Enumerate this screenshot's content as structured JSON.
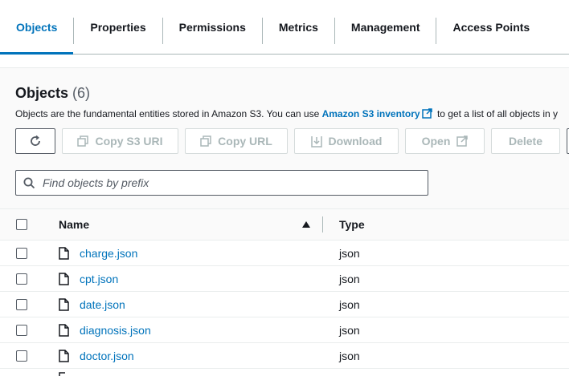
{
  "tabs": [
    {
      "label": "Objects",
      "active": true
    },
    {
      "label": "Properties",
      "active": false
    },
    {
      "label": "Permissions",
      "active": false
    },
    {
      "label": "Metrics",
      "active": false
    },
    {
      "label": "Management",
      "active": false
    },
    {
      "label": "Access Points",
      "active": false
    }
  ],
  "objects": {
    "title": "Objects",
    "count": "(6)",
    "description_before": "Objects are the fundamental entities stored in Amazon S3. You can use ",
    "description_link": "Amazon S3 inventory",
    "description_after": " to get a list of all objects in y"
  },
  "actions": {
    "copy_s3_uri": "Copy S3 URI",
    "copy_url": "Copy URL",
    "download": "Download",
    "open": "Open",
    "delete": "Delete"
  },
  "search": {
    "placeholder": "Find objects by prefix"
  },
  "table": {
    "columns": {
      "name": "Name",
      "type": "Type"
    },
    "rows": [
      {
        "name": "charge.json",
        "type": "json"
      },
      {
        "name": "cpt.json",
        "type": "json"
      },
      {
        "name": "date.json",
        "type": "json"
      },
      {
        "name": "diagnosis.json",
        "type": "json"
      },
      {
        "name": "doctor.json",
        "type": "json"
      }
    ]
  },
  "colors": {
    "accent": "#0073bb",
    "text": "#16191f",
    "muted": "#545b64",
    "disabled": "#aab7b8"
  }
}
